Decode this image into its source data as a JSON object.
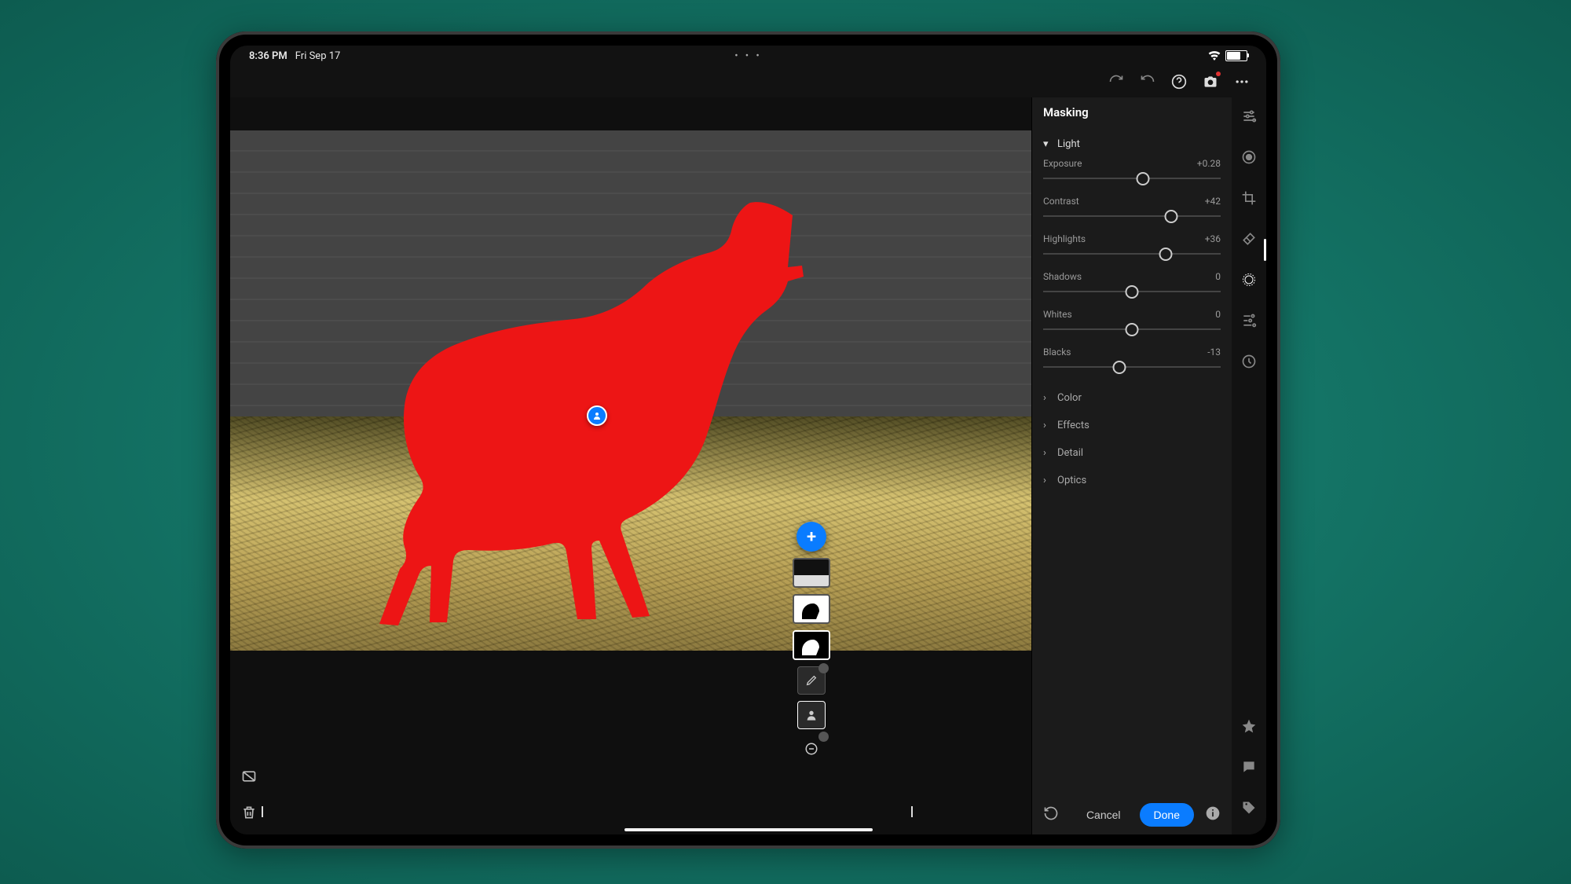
{
  "status": {
    "time": "8:36 PM",
    "date": "Fri Sep 17"
  },
  "panel": {
    "title": "Masking",
    "sections": {
      "light": {
        "label": "Light",
        "expanded": true,
        "sliders": [
          {
            "name": "Exposure",
            "value": "+0.28",
            "pos": 56
          },
          {
            "name": "Contrast",
            "value": "+42",
            "pos": 72
          },
          {
            "name": "Highlights",
            "value": "+36",
            "pos": 69
          },
          {
            "name": "Shadows",
            "value": "0",
            "pos": 50
          },
          {
            "name": "Whites",
            "value": "0",
            "pos": 50
          },
          {
            "name": "Blacks",
            "value": "-13",
            "pos": 43
          }
        ]
      },
      "color": {
        "label": "Color"
      },
      "effects": {
        "label": "Effects"
      },
      "detail": {
        "label": "Detail"
      },
      "optics": {
        "label": "Optics"
      }
    },
    "footer": {
      "cancel": "Cancel",
      "done": "Done"
    }
  }
}
